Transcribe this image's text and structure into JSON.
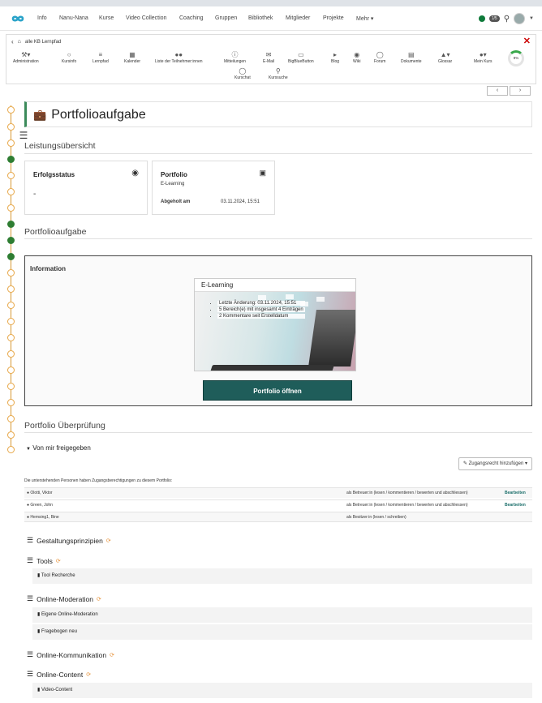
{
  "nav": {
    "items": [
      "Info",
      "Nanu-Nana",
      "Kurse",
      "Video Collection",
      "Coaching",
      "Gruppen",
      "Bibliothek",
      "Mitglieder",
      "Projekte",
      "Mehr ▾"
    ],
    "badge": "1/5"
  },
  "toolbar": {
    "breadcrumb": "alle KB Lernpfad",
    "tools": [
      {
        "label": "Administration",
        "icon": "wrench-icon"
      },
      {
        "label": "Kursinfo",
        "icon": "lightbulb-icon"
      },
      {
        "label": "Lernpfad",
        "icon": "signpost-icon"
      },
      {
        "label": "Kalender",
        "icon": "calendar-icon"
      },
      {
        "label": "Liste der Teilnehmer:innen",
        "icon": "users-icon"
      },
      {
        "label": "Mitteilungen",
        "icon": "info-icon"
      },
      {
        "label": "E-Mail",
        "icon": "envelope-icon"
      },
      {
        "label": "BigBlueButton",
        "icon": "monitor-icon"
      },
      {
        "label": "Blog",
        "icon": "megaphone-icon"
      },
      {
        "label": "Wiki",
        "icon": "globe-icon"
      },
      {
        "label": "Forum",
        "icon": "chat-icon"
      },
      {
        "label": "Dokumente",
        "icon": "folder-icon"
      },
      {
        "label": "Glossar",
        "icon": "graduation-icon"
      },
      {
        "label": "Mein Kurs",
        "icon": "user-icon"
      },
      {
        "label": "Kurschat",
        "icon": "speech-icon"
      },
      {
        "label": "Kurssuche",
        "icon": "search-icon"
      }
    ],
    "progress": "9%",
    "progress_value": 9
  },
  "page": {
    "title": "Portfolioaufgabe",
    "section_overview": "Leistungsübersicht",
    "status_card": {
      "title": "Erfolgsstatus",
      "value": "-"
    },
    "portfolio_card": {
      "title": "Portfolio",
      "subtitle": "E-Learning",
      "collected_label": "Abgeholt am",
      "collected_value": "03.11.2024, 15:51"
    },
    "section_task": "Portfolioaufgabe",
    "info_label": "Information",
    "preview": {
      "title": "E-Learning",
      "lines": [
        "Letzte Änderung: 03.11.2024, 15:51",
        "5 Bereich(e) mit insgesamt 4 Einträgen",
        "2 Kommentare seit Erstelldatum"
      ]
    },
    "open_button": "Portfolio öffnen",
    "section_review": "Portfolio Überprüfung",
    "shared_toggle": "Von mir freigegeben",
    "share_button": "Zugangsrecht hinzufügen",
    "access_text": "Die unterstehenden Personen haben Zugangsberechtigungen zu diesem Portfolio:",
    "access_rows": [
      {
        "name": "Olotti, Viktor",
        "role": "als Betreuer:in (lesen / kommentieren / bewerten und abschliessen)",
        "action": "Bearbeiten"
      },
      {
        "name": "Green, John",
        "role": "als Betreuer:in (lesen / kommentieren / bewerten und abschliessen)",
        "action": "Bearbeiten"
      },
      {
        "name": "Hemsing1, Bine",
        "role": "als Besitzer:in (lesen / schreiben)",
        "action": ""
      }
    ],
    "topics": [
      {
        "title": "Gestaltungsprinzipien",
        "items": []
      },
      {
        "title": "Tools",
        "items": [
          "Tool Recherche"
        ]
      },
      {
        "title": "Online-Moderation",
        "items": [
          "Eigene Online-Moderation",
          "Fragebogen neu"
        ]
      },
      {
        "title": "Online-Kommunikation",
        "items": []
      },
      {
        "title": "Online-Content",
        "items": [
          "Video-Content"
        ]
      }
    ]
  },
  "colors": {
    "accent": "#1f5d5a",
    "path": "#e7a646",
    "done": "#2e7d32",
    "close": "#cc0000"
  }
}
